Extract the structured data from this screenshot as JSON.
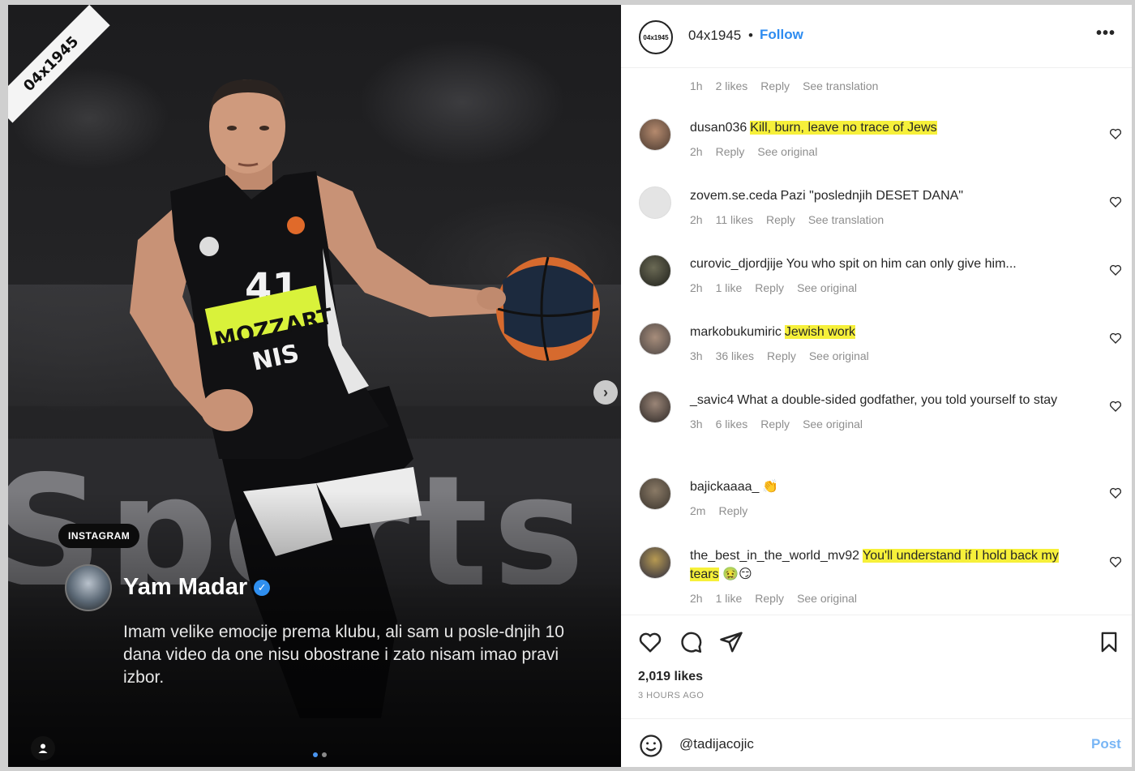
{
  "media": {
    "corner_brand": "04x1945",
    "chip_label": "INSTAGRAM",
    "quote_name": "Yam Madar",
    "quote_text": "Imam velike emocije prema klubu, ali sam u posle-dnjih 10 dana video da one nisu obostrane i zato nisam imao pravi izbor.",
    "jersey_number": "41",
    "jersey_sponsor": "MOZZART",
    "jersey_sponsor2": "NIS",
    "carousel_dots": 2,
    "carousel_active": 0
  },
  "header": {
    "username": "04x1945",
    "separator": "•",
    "follow_label": "Follow",
    "more_label": "•••"
  },
  "top_meta": {
    "time": "1h",
    "likes": "2 likes",
    "reply": "Reply",
    "translate": "See translation"
  },
  "comments": [
    {
      "user": "dusan036",
      "text": "Kill, burn, leave no trace of Jews",
      "highlight": true,
      "time": "2h",
      "likes": "",
      "reply": "Reply",
      "extra": "See original"
    },
    {
      "user": "zovem.se.ceda",
      "text": "Pazi \"poslednjih DESET DANA\"",
      "highlight": false,
      "time": "2h",
      "likes": "11 likes",
      "reply": "Reply",
      "extra": "See translation"
    },
    {
      "user": "curovic_djordjije",
      "text": "You who spit on him can only give him...",
      "highlight": false,
      "time": "2h",
      "likes": "1 like",
      "reply": "Reply",
      "extra": "See original"
    },
    {
      "user": "markobukumiric",
      "text": "Jewish work",
      "highlight": true,
      "time": "3h",
      "likes": "36 likes",
      "reply": "Reply",
      "extra": "See original"
    },
    {
      "user": "_savic4",
      "text": "What a double-sided godfather, you told yourself to stay",
      "highlight": false,
      "time": "3h",
      "likes": "6 likes",
      "reply": "Reply",
      "extra": "See original"
    },
    {
      "user": "bajickaaaa_",
      "text": "👏",
      "highlight": false,
      "time": "2m",
      "likes": "",
      "reply": "Reply",
      "extra": ""
    },
    {
      "user": "the_best_in_the_world_mv92",
      "text": "You'll understand if I hold back my tears",
      "highlight": true,
      "emoji": "🤢😏",
      "time": "2h",
      "likes": "1 like",
      "reply": "Reply",
      "extra": "See original"
    }
  ],
  "footer": {
    "likes": "2,019 likes",
    "time_ago": "3 HOURS AGO",
    "comment_value": "@tadijacojic",
    "post_label": "Post"
  },
  "colors": {
    "accent": "#2e8cf0",
    "highlight": "#f6f03a"
  }
}
